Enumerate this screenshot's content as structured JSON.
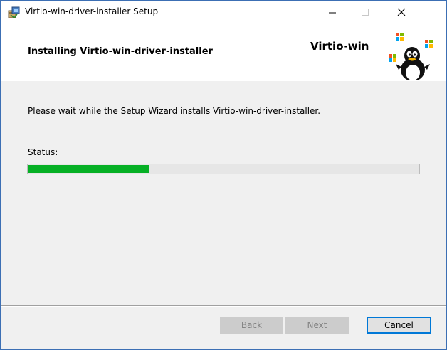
{
  "window": {
    "title": "Virtio-win-driver-installer Setup",
    "controls": {
      "minimize": "—",
      "maximize": "☐",
      "close": "✕"
    }
  },
  "banner": {
    "title": "Installing Virtio-win-driver-installer",
    "brand": "Virtio-win",
    "logo_icon": "tux-with-windows-flags-icon"
  },
  "body": {
    "description": "Please wait while the Setup Wizard installs Virtio-win-driver-installer.",
    "status_label": "Status:",
    "progress_fraction": 0.31,
    "progress_color": "#06b025"
  },
  "buttons": {
    "back": "Back",
    "next": "Next",
    "cancel": "Cancel"
  },
  "colors": {
    "accent": "#0078d7",
    "window_border": "#3c6fb4",
    "dialog_background": "#f0f0f0"
  }
}
